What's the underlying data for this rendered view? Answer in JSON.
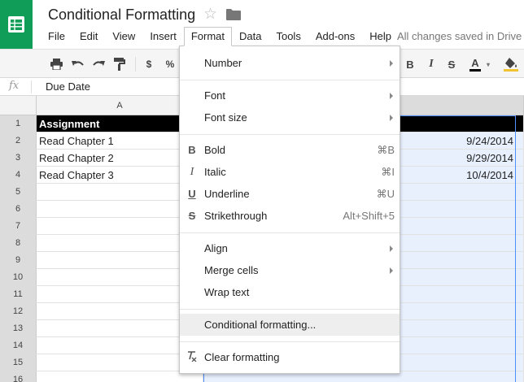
{
  "document": {
    "title": "Conditional Formatting",
    "save_status": "All changes saved in Drive"
  },
  "menubar": [
    "File",
    "Edit",
    "View",
    "Insert",
    "Format",
    "Data",
    "Tools",
    "Add-ons",
    "Help"
  ],
  "active_menu": "Format",
  "toolbar": {
    "currency_label": "$",
    "percent_label": "%"
  },
  "formula_bar": {
    "fx_label": "fx",
    "value": "Due Date"
  },
  "sheet": {
    "column_a_header": "A",
    "rows": [
      "1",
      "2",
      "3",
      "4",
      "5",
      "6",
      "7",
      "8",
      "9",
      "10",
      "11",
      "12",
      "13",
      "14",
      "15",
      "16"
    ],
    "column_a": [
      "Assignment",
      "Read Chapter 1",
      "Read Chapter 2",
      "Read Chapter 3"
    ],
    "column_b": [
      "",
      "9/24/2014",
      "9/29/2014",
      "10/4/2014"
    ]
  },
  "format_menu": {
    "number": "Number",
    "font": "Font",
    "font_size": "Font size",
    "bold": "Bold",
    "bold_shortcut": "⌘B",
    "italic": "Italic",
    "italic_shortcut": "⌘I",
    "underline": "Underline",
    "underline_shortcut": "⌘U",
    "strikethrough": "Strikethrough",
    "strikethrough_shortcut": "Alt+Shift+5",
    "align": "Align",
    "merge_cells": "Merge cells",
    "wrap_text": "Wrap text",
    "conditional_formatting": "Conditional formatting...",
    "clear_formatting": "Clear formatting"
  },
  "colors": {
    "app_green": "#0f9d58",
    "selection_blue": "#4d90fe",
    "selection_fill": "#e8f0fe"
  }
}
